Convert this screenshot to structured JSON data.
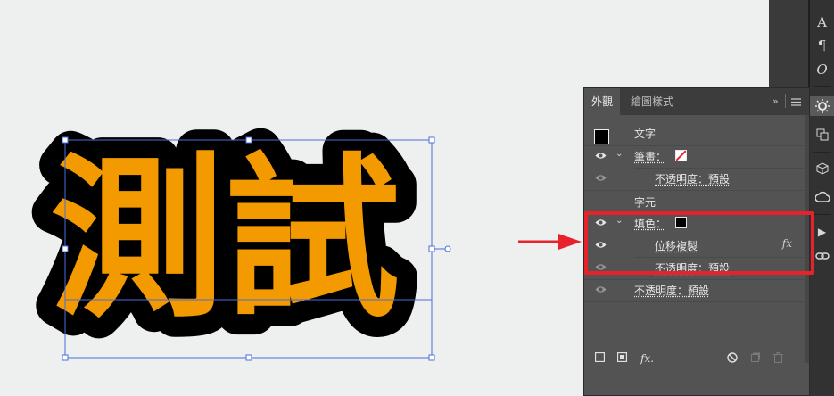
{
  "artwork": {
    "text": "測試",
    "fill_color": "#f39a00",
    "stroke_color": "#000000",
    "selection_color": "#4a6ee0"
  },
  "panel": {
    "tabs": [
      {
        "label": "外觀",
        "active": true
      },
      {
        "label": "繪圖樣式",
        "active": false
      }
    ],
    "header_collapse": "»",
    "menu_icon": "panel-menu-icon",
    "rows": {
      "text_label": "文字",
      "stroke_label": "筆畫：",
      "stroke_opacity": "不透明度：預設",
      "characters_label": "字元",
      "fill_label": "填色：",
      "offset_copy": "位移複製",
      "fill_opacity": "不透明度：預設",
      "opacity": "不透明度：預設"
    },
    "fx_label": "fx"
  },
  "colors": {
    "highlight": "#e8222b",
    "arrow": "#e8222b",
    "panel_bg": "#535353"
  }
}
